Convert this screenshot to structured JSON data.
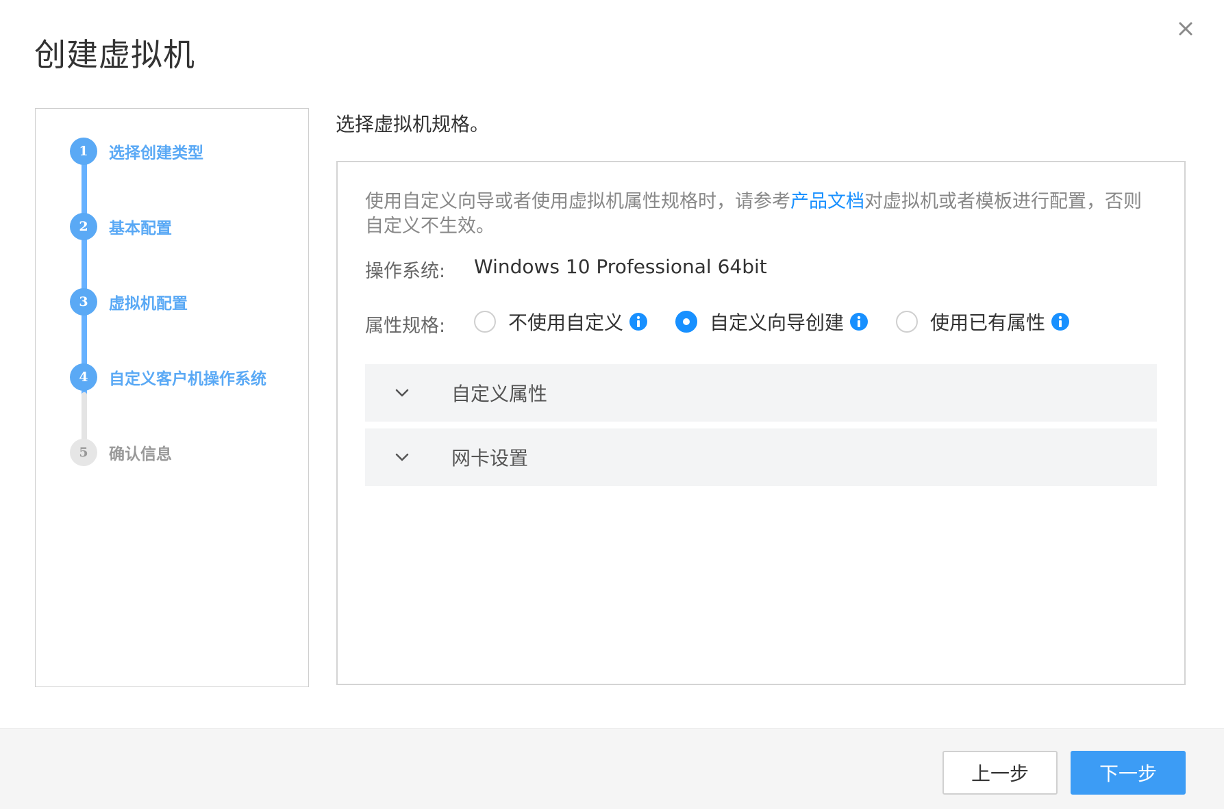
{
  "dialog": {
    "title": "创建虚拟机",
    "close_icon": "close-icon"
  },
  "steps": [
    {
      "number": "1",
      "label": "选择创建类型",
      "state": "done"
    },
    {
      "number": "2",
      "label": "基本配置",
      "state": "done"
    },
    {
      "number": "3",
      "label": "虚拟机配置",
      "state": "done"
    },
    {
      "number": "4",
      "label": "自定义客户机操作系统",
      "state": "current"
    },
    {
      "number": "5",
      "label": "确认信息",
      "state": "todo"
    }
  ],
  "main": {
    "section_title": "选择虚拟机规格。",
    "description_prefix": "使用自定义向导或者使用虚拟机属性规格时，请参考",
    "description_link": "产品文档",
    "description_suffix": "对虚拟机或者模板进行配置，否则自定义不生效。",
    "os_label": "操作系统:",
    "os_value": "Windows 10 Professional 64bit",
    "spec_label": "属性规格:",
    "spec_options": [
      {
        "label": "不使用自定义",
        "checked": false
      },
      {
        "label": "自定义向导创建",
        "checked": true
      },
      {
        "label": "使用已有属性",
        "checked": false
      }
    ],
    "collapses": [
      {
        "label": "自定义属性"
      },
      {
        "label": "网卡设置"
      }
    ]
  },
  "footer": {
    "prev_label": "上一步",
    "next_label": "下一步"
  },
  "colors": {
    "accent": "#1890ff",
    "step_done": "#5aa9f5",
    "step_todo": "#e6e6e6",
    "next_button": "#3c9cf5"
  }
}
